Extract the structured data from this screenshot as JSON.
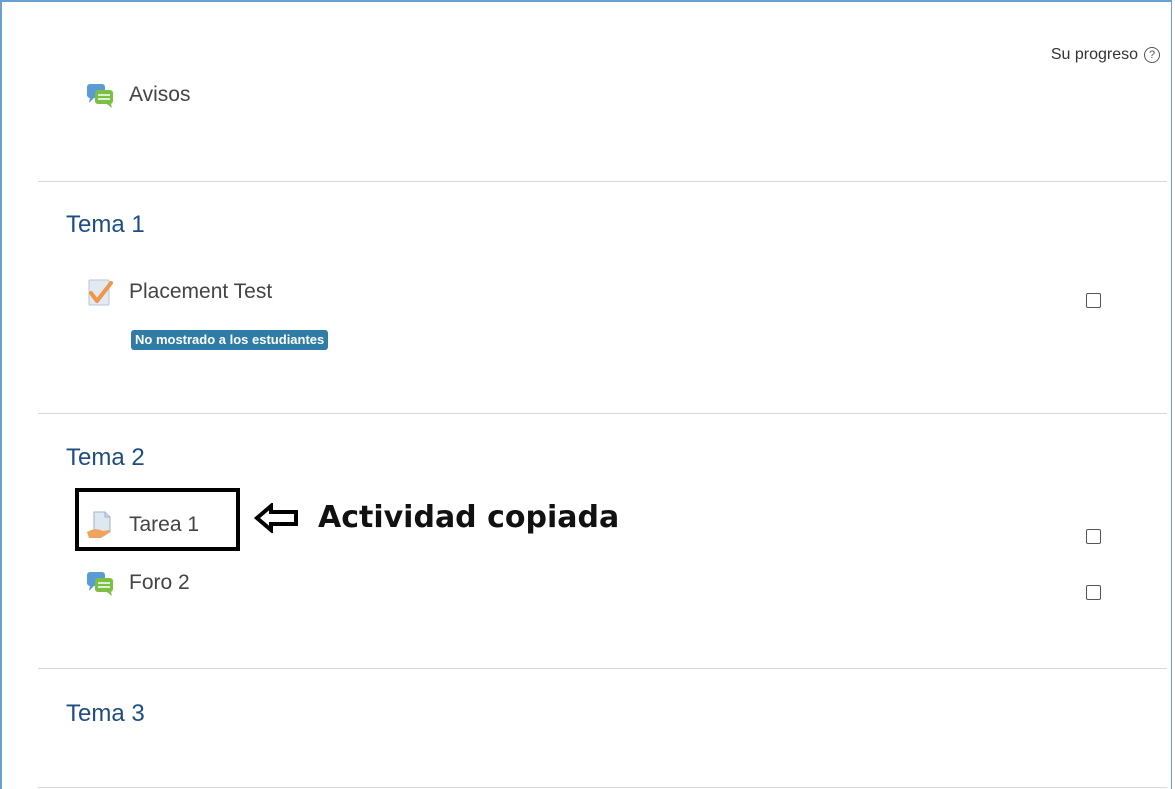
{
  "header": {
    "progress_label": "Su progreso",
    "help_glyph": "?"
  },
  "sections": [
    {
      "title": "",
      "activities": [
        {
          "label": "Avisos",
          "icon": "forum-icon"
        }
      ]
    },
    {
      "title": "Tema 1",
      "activities": [
        {
          "label": "Placement Test",
          "icon": "quiz-icon",
          "badge": "No mostrado a los estudiantes",
          "completed": false
        }
      ]
    },
    {
      "title": "Tema 2",
      "activities": [
        {
          "label": "Tarea 1",
          "icon": "assignment-icon",
          "completed": false
        },
        {
          "label": "Foro 2",
          "icon": "forum-icon",
          "completed": false
        }
      ]
    },
    {
      "title": "Tema 3",
      "activities": []
    }
  ],
  "annotation": {
    "text": "Actividad copiada"
  },
  "colors": {
    "section_title": "#1d4d84",
    "badge_bg": "#2f7da6",
    "frame": "#6a9fd4"
  }
}
